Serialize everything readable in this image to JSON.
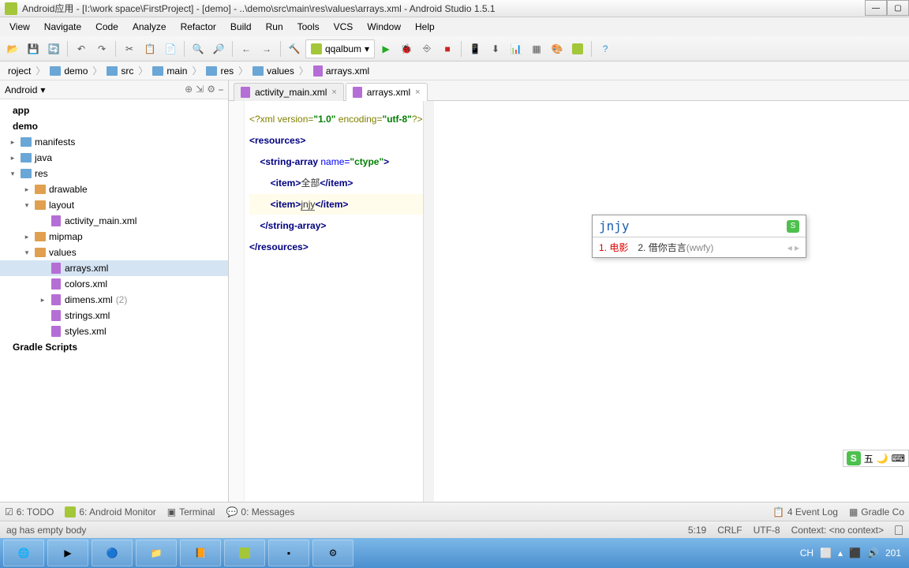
{
  "title": "Android应用 - [I:\\work space\\FirstProject] - [demo] - ..\\demo\\src\\main\\res\\values\\arrays.xml - Android Studio 1.5.1",
  "menus": [
    "View",
    "Navigate",
    "Code",
    "Analyze",
    "Refactor",
    "Build",
    "Run",
    "Tools",
    "VCS",
    "Window",
    "Help"
  ],
  "run_config": "qqalbum",
  "breadcrumb": [
    "demo",
    "src",
    "main",
    "res",
    "values",
    "arrays.xml"
  ],
  "project_dropdown": "Android",
  "tree": {
    "app": "app",
    "demo": "demo",
    "manifests": "manifests",
    "java": "java",
    "res": "res",
    "drawable": "drawable",
    "layout": "layout",
    "activity_main": "activity_main.xml",
    "mipmap": "mipmap",
    "values": "values",
    "arrays": "arrays.xml",
    "colors": "colors.xml",
    "dimens": "dimens.xml",
    "dimens_count": "(2)",
    "strings": "strings.xml",
    "styles": "styles.xml",
    "gradle": "Gradle Scripts"
  },
  "tabs": [
    {
      "label": "activity_main.xml",
      "active": false
    },
    {
      "label": "arrays.xml",
      "active": true
    }
  ],
  "code": {
    "l1_a": "<?xml version=",
    "l1_b": "\"1.0\"",
    "l1_c": " encoding=",
    "l1_d": "\"utf-8\"",
    "l1_e": "?>",
    "l2": "<resources>",
    "l3_a": "    <string-array ",
    "l3_b": "name=",
    "l3_c": "\"ctype\"",
    "l3_d": ">",
    "l4_a": "        <item>",
    "l4_b": "全部",
    "l4_c": "</item>",
    "l5_a": "        <item>",
    "l5_b": "jnjy",
    "l5_c": "</item>",
    "l6": "    </string-array>",
    "l7": "</resources>"
  },
  "ime": {
    "input": "jnjy",
    "cand1_num": "1.",
    "cand1_txt": "电影",
    "cand2_num": "2.",
    "cand2_txt": "借你吉言",
    "cand2_py": "(wwfy)"
  },
  "bottom": {
    "todo": "6: TODO",
    "android_monitor": "6: Android Monitor",
    "terminal": "Terminal",
    "messages": "0: Messages",
    "event_log": "4  Event Log",
    "gradle": "Gradle Co"
  },
  "status": {
    "msg": "ag has empty body",
    "pos": "5:19",
    "crlf": "CRLF",
    "enc": "UTF-8",
    "context": "Context: <no context>"
  },
  "tray": {
    "lang": "CH",
    "time": "201"
  },
  "sogou": "五"
}
